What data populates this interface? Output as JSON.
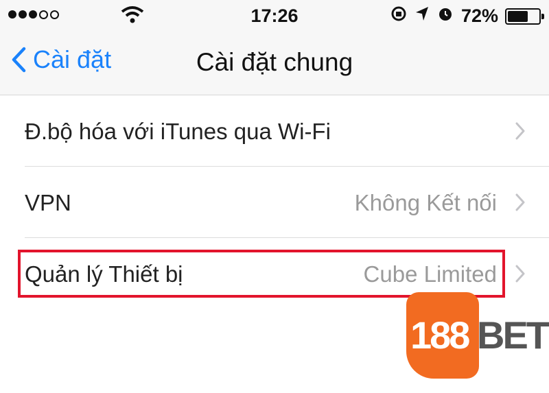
{
  "status_bar": {
    "time": "17:26",
    "battery_percent": "72%",
    "battery_level": 0.72,
    "signal_dots_filled": 3,
    "signal_dots_total": 5
  },
  "nav": {
    "back_label": "Cài đặt",
    "title": "Cài đặt chung"
  },
  "settings": {
    "items": [
      {
        "label": "Đ.bộ hóa với iTunes qua Wi-Fi",
        "value": ""
      },
      {
        "label": "VPN",
        "value": "Không Kết nối"
      },
      {
        "label": "Quản lý Thiết bị",
        "value": "Cube Limited"
      }
    ]
  },
  "logo": {
    "number": "188",
    "word": "BET",
    "badge_color": "#f26b21"
  },
  "colors": {
    "accent": "#1a82fb",
    "highlight": "#e2142c"
  }
}
